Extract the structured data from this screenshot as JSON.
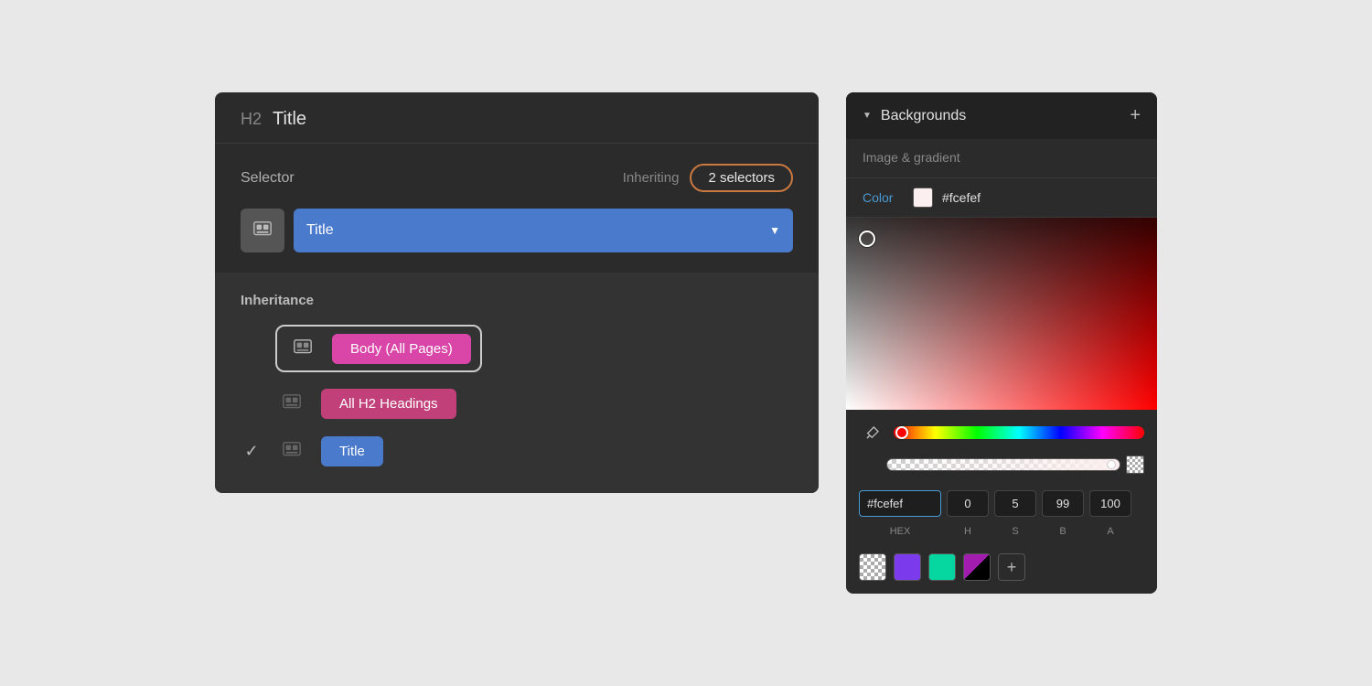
{
  "left_panel": {
    "header": {
      "h2_label": "H2",
      "title": "Title"
    },
    "selector": {
      "label": "Selector",
      "inheriting_text": "Inheriting",
      "badge_label": "2 selectors"
    },
    "dropdown": {
      "label": "Title"
    },
    "inheritance": {
      "title": "Inheritance",
      "items": [
        {
          "id": "body",
          "label": "Body (All Pages)",
          "tag_class": "tag-body",
          "has_check": false,
          "outlined": true
        },
        {
          "id": "h2",
          "label": "All H2 Headings",
          "tag_class": "tag-h2",
          "has_check": false,
          "outlined": false
        },
        {
          "id": "title",
          "label": "Title",
          "tag_class": "tag-title-blue",
          "has_check": true,
          "outlined": false
        }
      ]
    }
  },
  "right_panel": {
    "header": {
      "title": "Backgrounds"
    },
    "image_gradient_label": "Image & gradient",
    "color": {
      "label": "Color",
      "hex": "#fcefef"
    },
    "inputs": {
      "hex_value": "#fcefef",
      "h": "0",
      "s": "5",
      "b": "99",
      "a": "100",
      "hex_label": "HEX",
      "h_label": "H",
      "s_label": "S",
      "b_label": "B",
      "a_label": "A"
    }
  }
}
